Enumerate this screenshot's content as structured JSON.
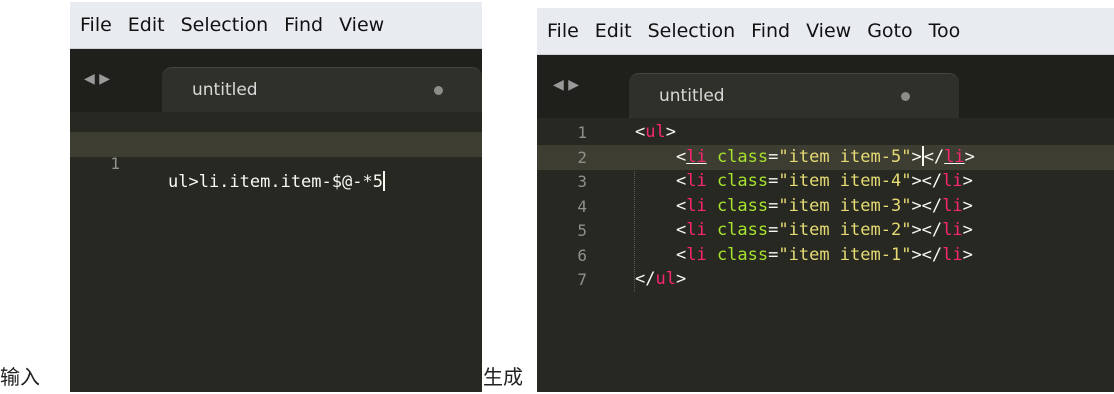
{
  "captions": {
    "input": "输入",
    "output": "生成"
  },
  "menu": [
    "File",
    "Edit",
    "Selection",
    "Find",
    "View",
    "Goto",
    "Too"
  ],
  "nav": {
    "arrows": "◀ ▶"
  },
  "tab": {
    "label": "untitled"
  },
  "input_editor": {
    "line_number": "1",
    "text": "ul>li.item.item-$@-*5"
  },
  "output_editor": {
    "lines": [
      {
        "num": "1",
        "tokens": [
          [
            "punc",
            "<"
          ],
          [
            "tag",
            "ul"
          ],
          [
            "punc",
            ">"
          ]
        ]
      },
      {
        "num": "2",
        "tokens": [
          [
            "plain",
            "    "
          ],
          [
            "punc",
            "<"
          ],
          [
            "tagu",
            "li"
          ],
          [
            "plain",
            " "
          ],
          [
            "attr",
            "class"
          ],
          [
            "punc",
            "="
          ],
          [
            "str",
            "\"item item-5\""
          ],
          [
            "punc",
            ">"
          ],
          [
            "caret",
            ""
          ],
          [
            "punc",
            "</"
          ],
          [
            "tagu",
            "li"
          ],
          [
            "punc",
            ">"
          ]
        ]
      },
      {
        "num": "3",
        "tokens": [
          [
            "plain",
            "    "
          ],
          [
            "punc",
            "<"
          ],
          [
            "tag",
            "li"
          ],
          [
            "plain",
            " "
          ],
          [
            "attr",
            "class"
          ],
          [
            "punc",
            "="
          ],
          [
            "str",
            "\"item item-4\""
          ],
          [
            "punc",
            "></"
          ],
          [
            "tag",
            "li"
          ],
          [
            "punc",
            ">"
          ]
        ]
      },
      {
        "num": "4",
        "tokens": [
          [
            "plain",
            "    "
          ],
          [
            "punc",
            "<"
          ],
          [
            "tag",
            "li"
          ],
          [
            "plain",
            " "
          ],
          [
            "attr",
            "class"
          ],
          [
            "punc",
            "="
          ],
          [
            "str",
            "\"item item-3\""
          ],
          [
            "punc",
            "></"
          ],
          [
            "tag",
            "li"
          ],
          [
            "punc",
            ">"
          ]
        ]
      },
      {
        "num": "5",
        "tokens": [
          [
            "plain",
            "    "
          ],
          [
            "punc",
            "<"
          ],
          [
            "tag",
            "li"
          ],
          [
            "plain",
            " "
          ],
          [
            "attr",
            "class"
          ],
          [
            "punc",
            "="
          ],
          [
            "str",
            "\"item item-2\""
          ],
          [
            "punc",
            "></"
          ],
          [
            "tag",
            "li"
          ],
          [
            "punc",
            ">"
          ]
        ]
      },
      {
        "num": "6",
        "tokens": [
          [
            "plain",
            "    "
          ],
          [
            "punc",
            "<"
          ],
          [
            "tag",
            "li"
          ],
          [
            "plain",
            " "
          ],
          [
            "attr",
            "class"
          ],
          [
            "punc",
            "="
          ],
          [
            "str",
            "\"item item-1\""
          ],
          [
            "punc",
            "></"
          ],
          [
            "tag",
            "li"
          ],
          [
            "punc",
            ">"
          ]
        ]
      },
      {
        "num": "7",
        "tokens": [
          [
            "punc",
            "</"
          ],
          [
            "tag",
            "ul"
          ],
          [
            "punc",
            ">"
          ]
        ]
      }
    ]
  },
  "colors": {
    "editor_bg": "#272822",
    "tag": "#f92672",
    "attribute": "#a6e22e",
    "string": "#e6db74",
    "text": "#f8f8f2",
    "line_number": "#8f908a"
  },
  "icons": {
    "tab_modified": "circle-dot-icon",
    "nav": "triangle-arrows-icon"
  }
}
